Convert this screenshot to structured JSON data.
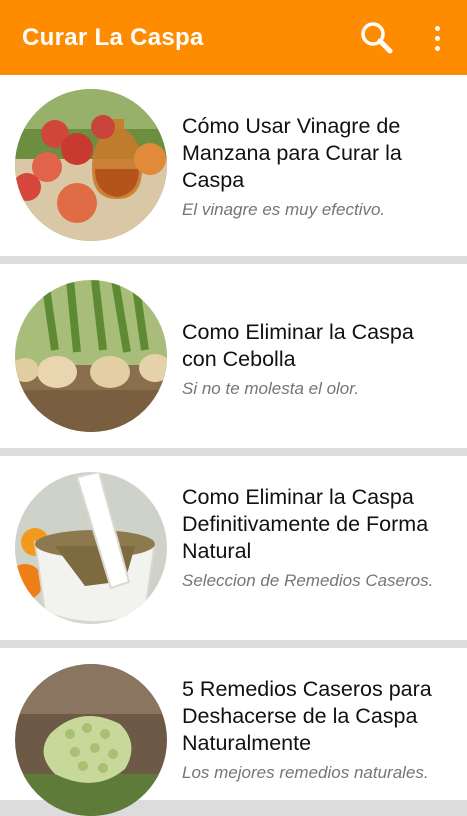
{
  "appbar": {
    "title": "Curar La Caspa",
    "color": "#ff8c00",
    "actions": [
      {
        "icon": "search-icon"
      },
      {
        "icon": "more-vert-icon"
      }
    ]
  },
  "articles": [
    {
      "title": "Cómo Usar Vinagre de Manzana para Curar la Caspa",
      "subtitle": "El vinagre es muy efectivo.",
      "image": "apples-and-vinegar-cruet"
    },
    {
      "title": "Como Eliminar la Caspa con Cebolla",
      "subtitle": "Si no te molesta el olor.",
      "image": "onions-in-soil"
    },
    {
      "title": "Como Eliminar la Caspa Definitivamente de Forma Natural",
      "subtitle": "Seleccion de Remedios Caseros.",
      "image": "herbs-in-mortar-and-pestle"
    },
    {
      "title": "5 Remedios Caseros para Deshacerse de la Caspa Naturalmente",
      "subtitle": "Los mejores remedios naturales.",
      "image": "noni-fruit-on-grass"
    }
  ]
}
